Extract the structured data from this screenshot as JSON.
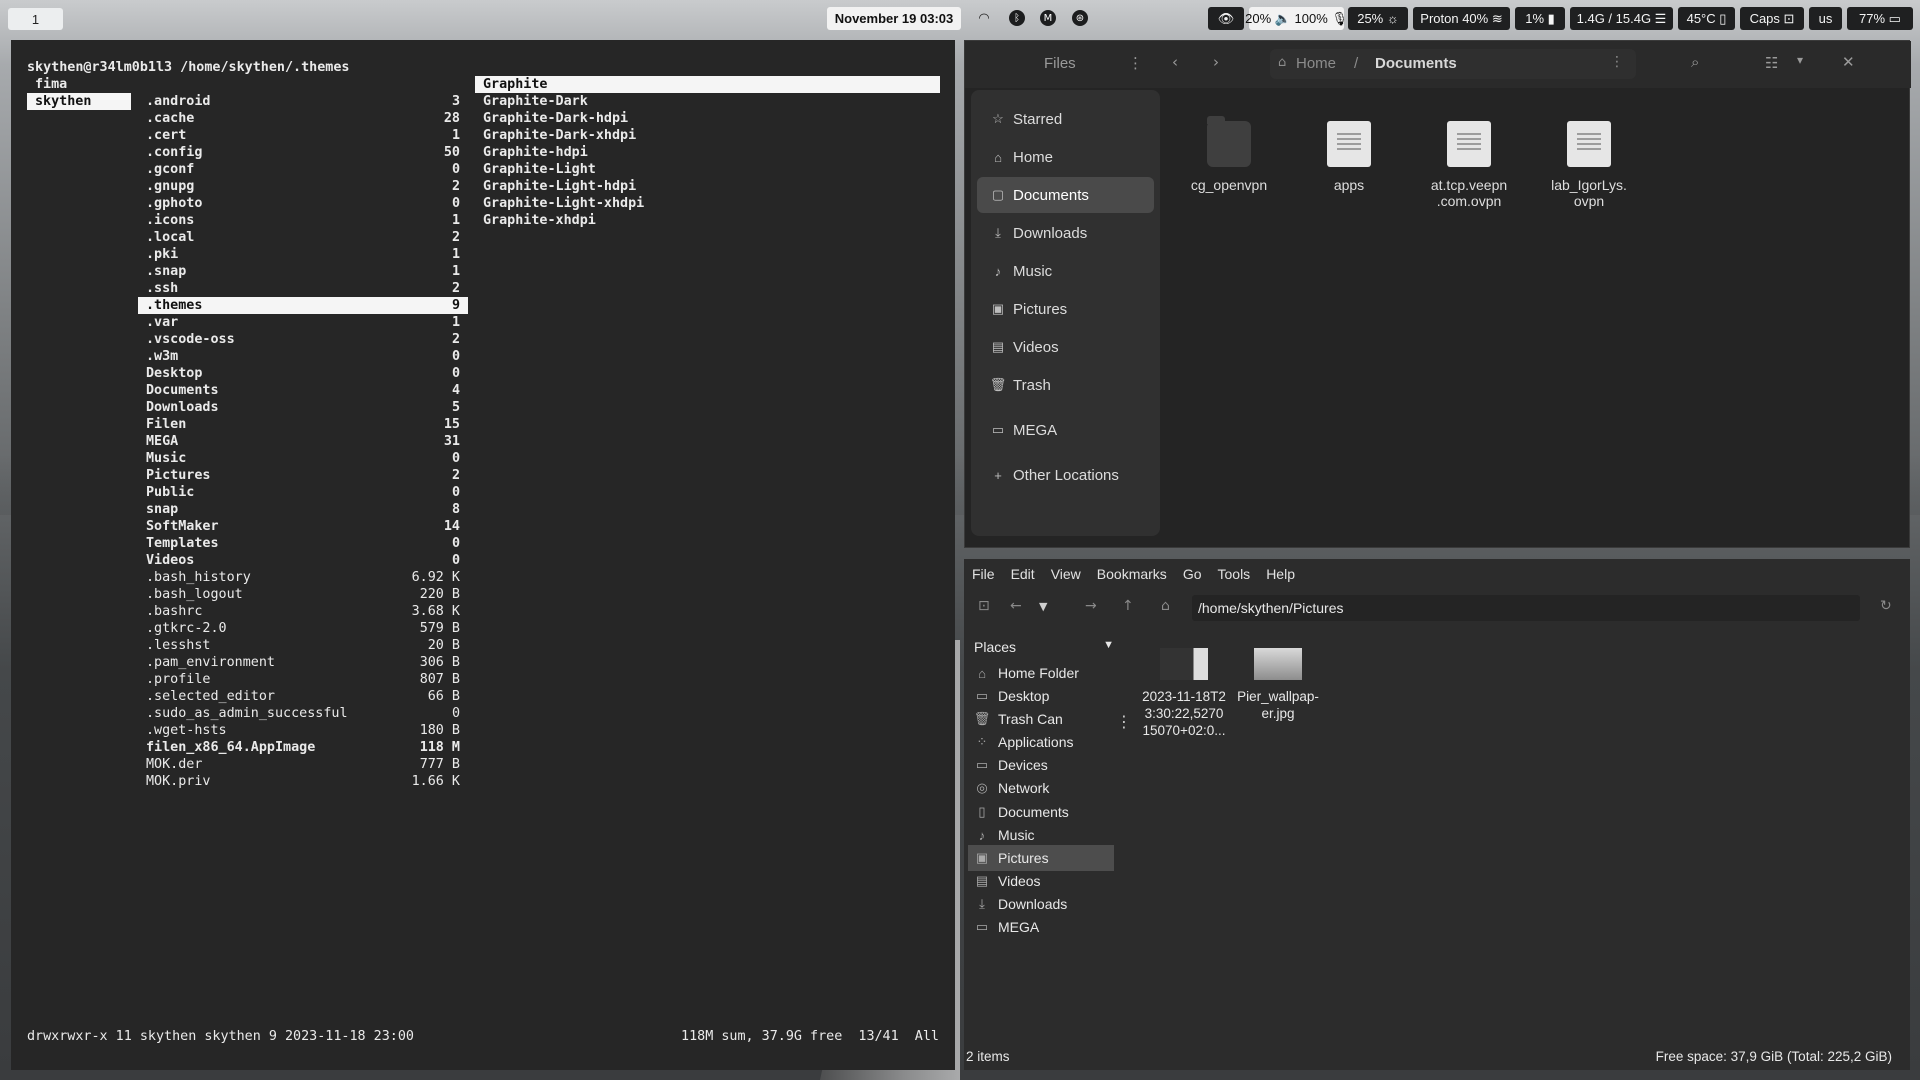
{
  "topbar": {
    "workspace": "1",
    "datetime": "November 19  03:03",
    "audio": "20% 🔈 100% 🎙",
    "brightness": "25% ☼",
    "vpn": "Proton 40% ≋",
    "cpu": "1% ▮",
    "mem": "1.4G / 15.4G ☰",
    "temp": "45°C ▯",
    "caps": "Caps ⊡",
    "layout": "us",
    "battery": "77% ▭"
  },
  "ranger": {
    "header": "skythen@r34lm0b1l3 /home/skythen/.themes",
    "parent": [
      "fima",
      "skythen"
    ],
    "entries": [
      {
        "name": ".android",
        "size": "3"
      },
      {
        "name": ".cache",
        "size": "28"
      },
      {
        "name": ".cert",
        "size": "1"
      },
      {
        "name": ".config",
        "size": "50"
      },
      {
        "name": ".gconf",
        "size": "0"
      },
      {
        "name": ".gnupg",
        "size": "2"
      },
      {
        "name": ".gphoto",
        "size": "0"
      },
      {
        "name": ".icons",
        "size": "1"
      },
      {
        "name": ".local",
        "size": "2"
      },
      {
        "name": ".pki",
        "size": "1"
      },
      {
        "name": ".snap",
        "size": "1"
      },
      {
        "name": ".ssh",
        "size": "2"
      },
      {
        "name": ".themes",
        "size": "9"
      },
      {
        "name": ".var",
        "size": "1"
      },
      {
        "name": ".vscode-oss",
        "size": "2"
      },
      {
        "name": ".w3m",
        "size": "0"
      },
      {
        "name": "Desktop",
        "size": "0"
      },
      {
        "name": "Documents",
        "size": "4"
      },
      {
        "name": "Downloads",
        "size": "5"
      },
      {
        "name": "Filen",
        "size": "15"
      },
      {
        "name": "MEGA",
        "size": "31"
      },
      {
        "name": "Music",
        "size": "0"
      },
      {
        "name": "Pictures",
        "size": "2"
      },
      {
        "name": "Public",
        "size": "0"
      },
      {
        "name": "snap",
        "size": "8"
      },
      {
        "name": "SoftMaker",
        "size": "14"
      },
      {
        "name": "Templates",
        "size": "0"
      },
      {
        "name": "Videos",
        "size": "0"
      },
      {
        "name": ".bash_history",
        "size": "6.92 K"
      },
      {
        "name": ".bash_logout",
        "size": "220 B"
      },
      {
        "name": ".bashrc",
        "size": "3.68 K"
      },
      {
        "name": ".gtkrc-2.0",
        "size": "579 B"
      },
      {
        "name": ".lesshst",
        "size": "20 B"
      },
      {
        "name": ".pam_environment",
        "size": "306 B"
      },
      {
        "name": ".profile",
        "size": "807 B"
      },
      {
        "name": ".selected_editor",
        "size": "66 B"
      },
      {
        "name": ".sudo_as_admin_successful",
        "size": "0"
      },
      {
        "name": ".wget-hsts",
        "size": "180 B"
      },
      {
        "name": "filen_x86_64.AppImage",
        "size": "118 M"
      },
      {
        "name": "MOK.der",
        "size": "777 B"
      },
      {
        "name": "MOK.priv",
        "size": "1.66 K"
      }
    ],
    "preview": [
      "Graphite",
      "Graphite-Dark",
      "Graphite-Dark-hdpi",
      "Graphite-Dark-xhdpi",
      "Graphite-hdpi",
      "Graphite-Light",
      "Graphite-Light-hdpi",
      "Graphite-Light-xhdpi",
      "Graphite-xhdpi"
    ],
    "status_left": "drwxrwxr-x 11 skythen skythen 9 2023-11-18 23:00",
    "status_right": "118M sum, 37.9G free  13/41  All"
  },
  "nautilus": {
    "title": "Files",
    "crumb_home": "Home",
    "crumb_sep": "/",
    "crumb_current": "Documents",
    "sidebar": [
      {
        "label": "Starred",
        "icon": "☆"
      },
      {
        "label": "Home",
        "icon": "⌂"
      },
      {
        "label": "Documents",
        "icon": "▢"
      },
      {
        "label": "Downloads",
        "icon": "⤓"
      },
      {
        "label": "Music",
        "icon": "♪"
      },
      {
        "label": "Pictures",
        "icon": "▣"
      },
      {
        "label": "Videos",
        "icon": "▤"
      },
      {
        "label": "Trash",
        "icon": "🗑"
      },
      {
        "label": "MEGA",
        "icon": "▭"
      },
      {
        "label": "Other Locations",
        "icon": "+"
      }
    ],
    "files": [
      {
        "name": "cg_openvpn",
        "kind": "folder"
      },
      {
        "name": "apps",
        "kind": "doc"
      },
      {
        "name": "at.tcp.veepn\n.com.ovpn",
        "kind": "doc"
      },
      {
        "name": "lab_IgorLys.\novpn",
        "kind": "doc"
      }
    ]
  },
  "thunar": {
    "menu": [
      "File",
      "Edit",
      "View",
      "Bookmarks",
      "Go",
      "Tools",
      "Help"
    ],
    "path": "/home/skythen/Pictures",
    "places_label": "Places",
    "places": [
      {
        "label": "Home Folder",
        "icon": "⌂"
      },
      {
        "label": "Desktop",
        "icon": "▭"
      },
      {
        "label": "Trash Can",
        "icon": "🗑"
      },
      {
        "label": "Applications",
        "icon": "⁘"
      },
      {
        "label": "Devices",
        "icon": "▭"
      },
      {
        "label": "Network",
        "icon": "◎"
      },
      {
        "label": "Documents",
        "icon": "▯"
      },
      {
        "label": "Music",
        "icon": "♪"
      },
      {
        "label": "Pictures",
        "icon": "▣"
      },
      {
        "label": "Videos",
        "icon": "▤"
      },
      {
        "label": "Downloads",
        "icon": "⤓"
      },
      {
        "label": "MEGA",
        "icon": "▭"
      }
    ],
    "files": [
      {
        "name": "2023-11-18T2\n3:30:22,5270\n15070+02:0..."
      },
      {
        "name": "Pier_wallpap-\ner.jpg"
      }
    ],
    "status_left": "2 items",
    "status_right": "Free space: 37,9 GiB (Total: 225,2 GiB)"
  }
}
